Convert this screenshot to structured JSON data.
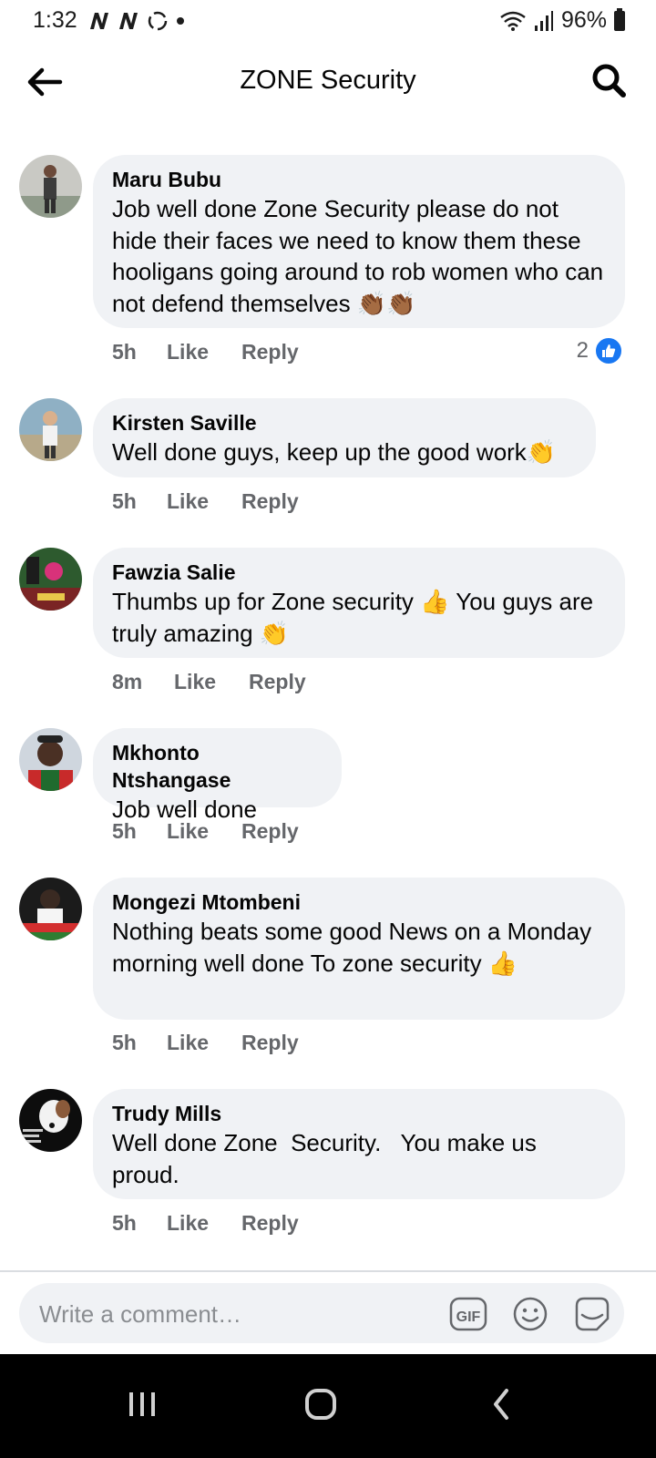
{
  "status_bar": {
    "time": "1:32",
    "battery": "96%"
  },
  "header": {
    "title": "ZONE Security"
  },
  "comments": [
    {
      "author": "Maru Bubu",
      "text": "Job well done Zone Security please do not hide their faces we need to know them these hooligans going around to rob women who can not defend themselves 👏🏾👏🏾",
      "time": "5h",
      "like": "Like",
      "reply": "Reply",
      "reactions": "2"
    },
    {
      "author": "Kirsten Saville",
      "text": "Well done guys, keep up the good work👏",
      "time": "5h",
      "like": "Like",
      "reply": "Reply"
    },
    {
      "author": "Fawzia Salie",
      "text": "Thumbs up for Zone security 👍 You guys are truly amazing 👏",
      "time": "8m",
      "like": "Like",
      "reply": "Reply"
    },
    {
      "author": "Mkhonto Ntshangase",
      "text": "Job well done",
      "time": "5h",
      "like": "Like",
      "reply": "Reply"
    },
    {
      "author": "Mongezi Mtombeni",
      "text": "Nothing beats some good News on a Monday morning well done To zone security 👍",
      "time": "5h",
      "like": "Like",
      "reply": "Reply"
    },
    {
      "author": "Trudy Mills",
      "text": "Well done Zone  Security.   You make us proud.",
      "time": "5h",
      "like": "Like",
      "reply": "Reply"
    }
  ],
  "composer": {
    "placeholder": "Write a comment…",
    "gif_label": "GIF"
  },
  "colors": {
    "accent": "#1877f2",
    "bubble": "#f0f2f5",
    "muted": "#65676b"
  }
}
